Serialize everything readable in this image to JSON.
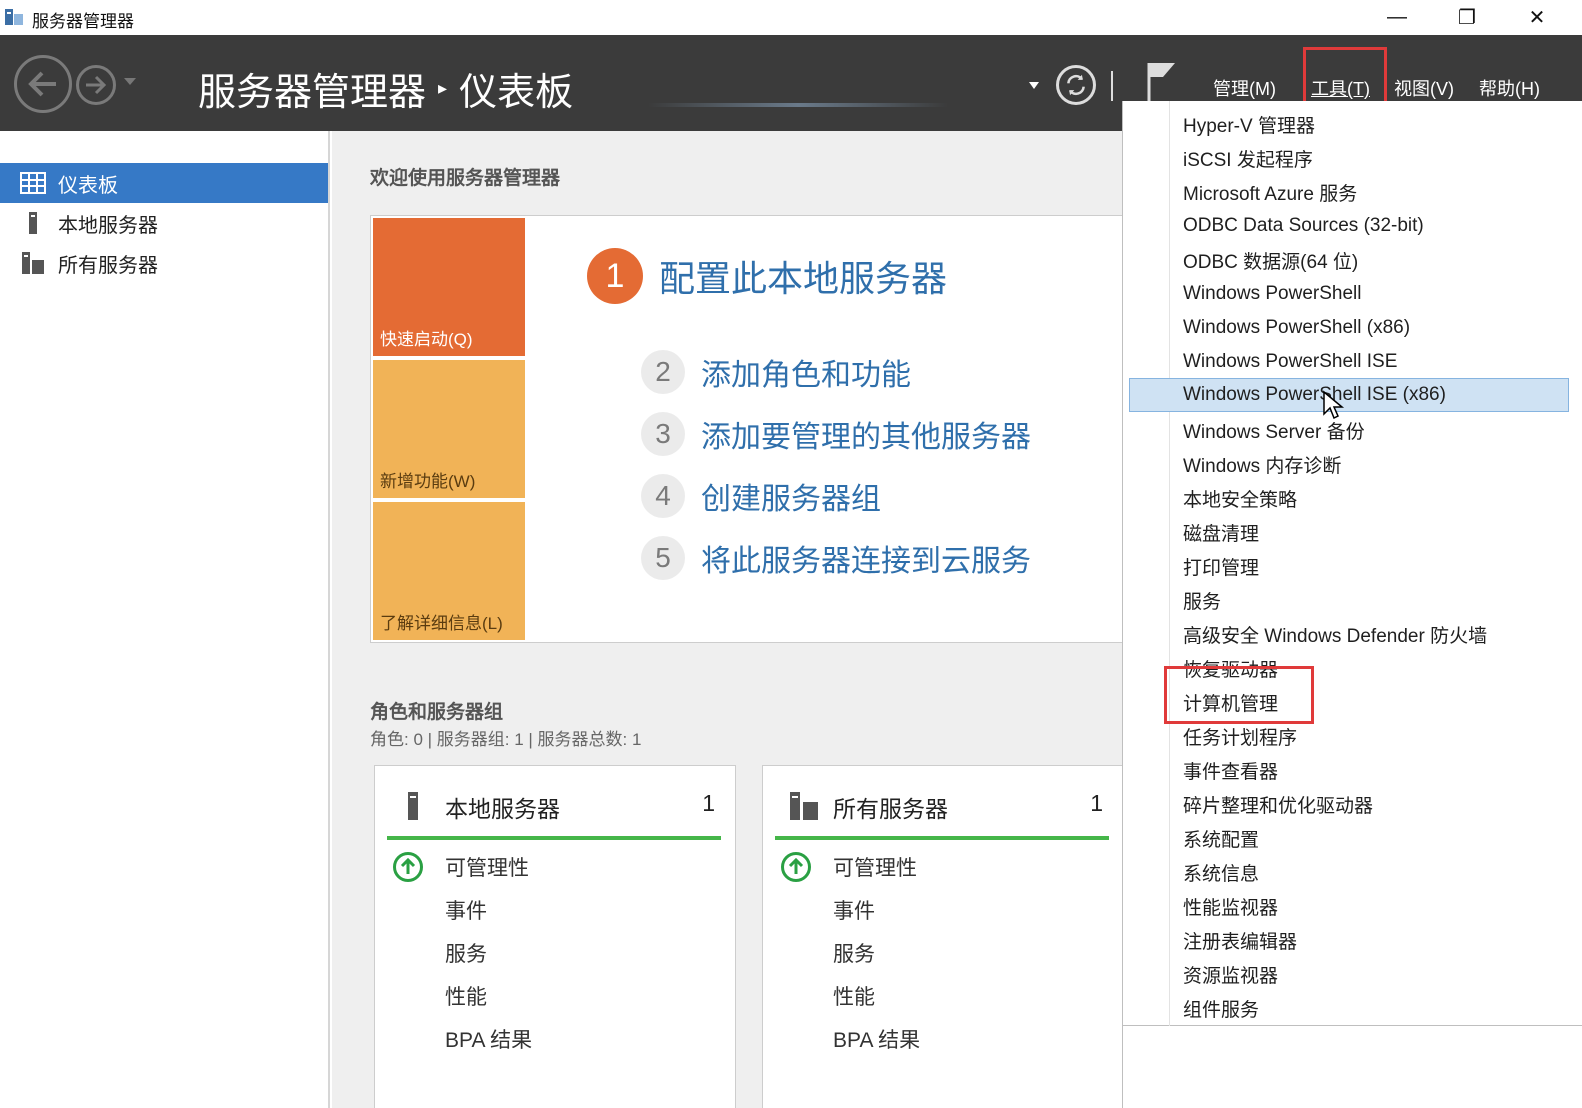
{
  "window": {
    "title": "服务器管理器",
    "minimize": "—",
    "restore": "❐",
    "close": "✕"
  },
  "header": {
    "app_name": "服务器管理器",
    "separator": "▸",
    "page": "仪表板",
    "menus": [
      {
        "label": "管理(M)"
      },
      {
        "label": "工具(T)"
      },
      {
        "label": "视图(V)"
      },
      {
        "label": "帮助(H)"
      }
    ]
  },
  "sidebar": {
    "items": [
      {
        "label": "仪表板",
        "icon": "dashboard-grid-icon",
        "active": true
      },
      {
        "label": "本地服务器",
        "icon": "server-tower-icon"
      },
      {
        "label": "所有服务器",
        "icon": "servers-icon"
      }
    ]
  },
  "main": {
    "welcome": "欢迎使用服务器管理器",
    "tiles": [
      "快速启动(Q)",
      "新增功能(W)",
      "了解详细信息(L)"
    ],
    "steps": [
      {
        "num": "1",
        "label": "配置此本地服务器"
      },
      {
        "num": "2",
        "label": "添加角色和功能"
      },
      {
        "num": "3",
        "label": "添加要管理的其他服务器"
      },
      {
        "num": "4",
        "label": "创建服务器组"
      },
      {
        "num": "5",
        "label": "将此服务器连接到云服务"
      }
    ],
    "roles_title": "角色和服务器组",
    "roles_sub": "角色: 0 | 服务器组: 1 | 服务器总数: 1",
    "cards": [
      {
        "title": "本地服务器",
        "count": "1",
        "rows": [
          "可管理性",
          "事件",
          "服务",
          "性能",
          "BPA 结果"
        ]
      },
      {
        "title": "所有服务器",
        "count": "1",
        "rows": [
          "可管理性",
          "事件",
          "服务",
          "性能",
          "BPA 结果"
        ]
      }
    ]
  },
  "tools_menu": {
    "items": [
      "Hyper-V 管理器",
      "iSCSI 发起程序",
      "Microsoft Azure 服务",
      "ODBC Data Sources (32-bit)",
      "ODBC 数据源(64 位)",
      "Windows PowerShell",
      "Windows PowerShell (x86)",
      "Windows PowerShell ISE",
      "Windows PowerShell ISE (x86)",
      "Windows Server 备份",
      "Windows 内存诊断",
      "本地安全策略",
      "磁盘清理",
      "打印管理",
      "服务",
      "高级安全 Windows Defender 防火墙",
      "恢复驱动器",
      "计算机管理",
      "任务计划程序",
      "事件查看器",
      "碎片整理和优化驱动器",
      "系统配置",
      "系统信息",
      "性能监视器",
      "注册表编辑器",
      "资源监视器",
      "组件服务"
    ],
    "highlighted_index": 8,
    "boxed_index": 17
  },
  "colors": {
    "header_bg": "#3b3b3b",
    "accent_blue": "#3679c6",
    "link_blue": "#2f6fab",
    "quick_orange": "#e46b34",
    "tile_yellow": "#f1b357",
    "status_green": "#45b649",
    "annotation_red": "#e03a3a"
  }
}
